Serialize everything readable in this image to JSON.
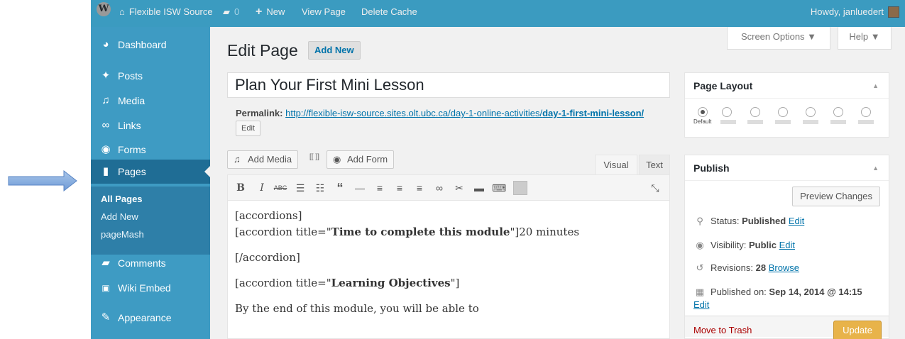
{
  "adminbar": {
    "site_name": "Flexible ISW Source",
    "comments_count": "0",
    "new_label": "New",
    "view_page": "View Page",
    "delete_cache": "Delete Cache",
    "howdy": "Howdy, janluedert"
  },
  "sidebar": {
    "dashboard": "Dashboard",
    "posts": "Posts",
    "media": "Media",
    "links": "Links",
    "forms": "Forms",
    "pages": "Pages",
    "submenu": [
      "All Pages",
      "Add New",
      "pageMash"
    ],
    "comments": "Comments",
    "wiki_embed": "Wiki Embed",
    "appearance": "Appearance"
  },
  "screen": {
    "screen_options": "Screen Options ▼",
    "help": "Help ▼"
  },
  "header": {
    "title": "Edit Page",
    "add_new": "Add New"
  },
  "post": {
    "title": "Plan Your First Mini Lesson",
    "permalink_label": "Permalink:",
    "permalink_base": "http://flexible-isw-source.sites.olt.ubc.ca/day-1-online-activities/",
    "permalink_slug": "day-1-first-mini-lesson/",
    "edit_label": "Edit"
  },
  "editor": {
    "add_media": "Add Media",
    "add_form": "Add Form",
    "tab_visual": "Visual",
    "tab_text": "Text",
    "lines": {
      "l1": "[accordions]",
      "l2_pre": "[accordion title=\"",
      "l2_bold": "Time to complete this module",
      "l2_post": "\"]20 minutes",
      "l3": "[/accordion]",
      "l4_pre": "[accordion title=\"",
      "l4_bold": "Learning Objectives",
      "l4_post": "\"]",
      "l5": "By the end of this module, you will be able to"
    }
  },
  "page_layout": {
    "title": "Page Layout",
    "default_label": "Default"
  },
  "publish": {
    "title": "Publish",
    "preview": "Preview Changes",
    "status_label": "Status:",
    "status_value": "Published",
    "visibility_label": "Visibility:",
    "visibility_value": "Public",
    "revisions_label": "Revisions:",
    "revisions_value": "28",
    "browse": "Browse",
    "published_on_label": "Published on:",
    "published_on_value": "Sep 14, 2014 @ 14:15",
    "edit": "Edit",
    "trash": "Move to Trash",
    "update": "Update"
  },
  "colors": {
    "admin_accent": "#3b9bc0",
    "current_menu": "#1f6d95",
    "update_button": "#e8b34a",
    "link": "#0073aa"
  }
}
